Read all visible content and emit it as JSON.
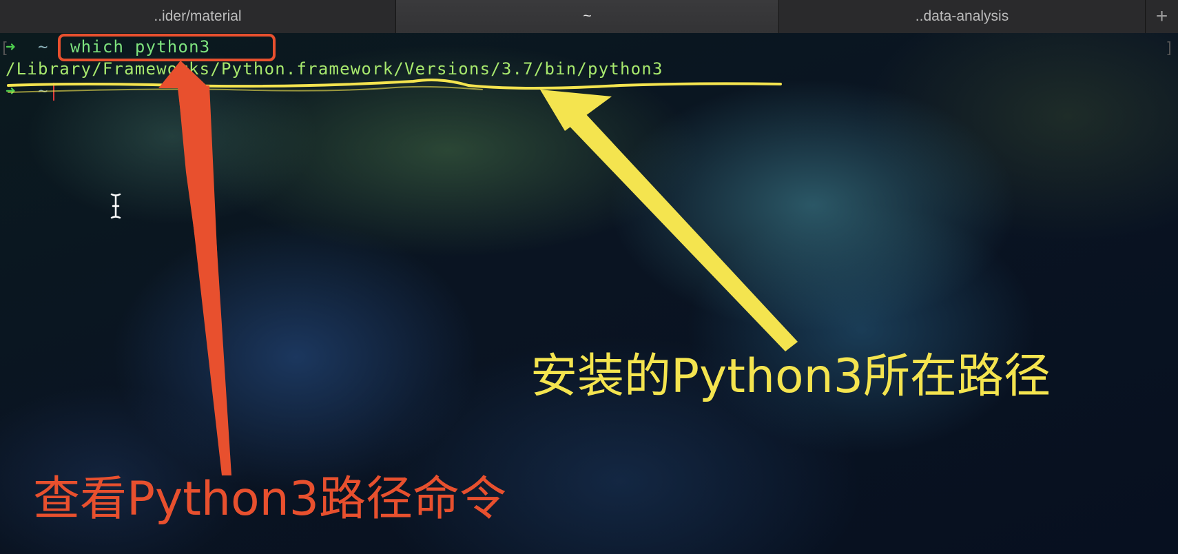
{
  "tabs": [
    {
      "label": "..ider/material",
      "active": false
    },
    {
      "label": "~",
      "active": true
    },
    {
      "label": "..data-analysis",
      "active": false
    }
  ],
  "tab_add_label": "+",
  "terminal": {
    "prompt_symbol": "➜",
    "cwd": "~",
    "command": "which python3",
    "output": "/Library/Frameworks/Python.framework/Versions/3.7/bin/python3"
  },
  "annotations": {
    "command_label": "查看Python3路径命令",
    "path_label": "安装的Python3所在路径",
    "command_color": "#e8502e",
    "path_color": "#f4e44f"
  },
  "colors": {
    "prompt": "#4fd14f",
    "command": "#7ee37e",
    "output": "#a7e86d",
    "cursor": "#e23a3a"
  }
}
